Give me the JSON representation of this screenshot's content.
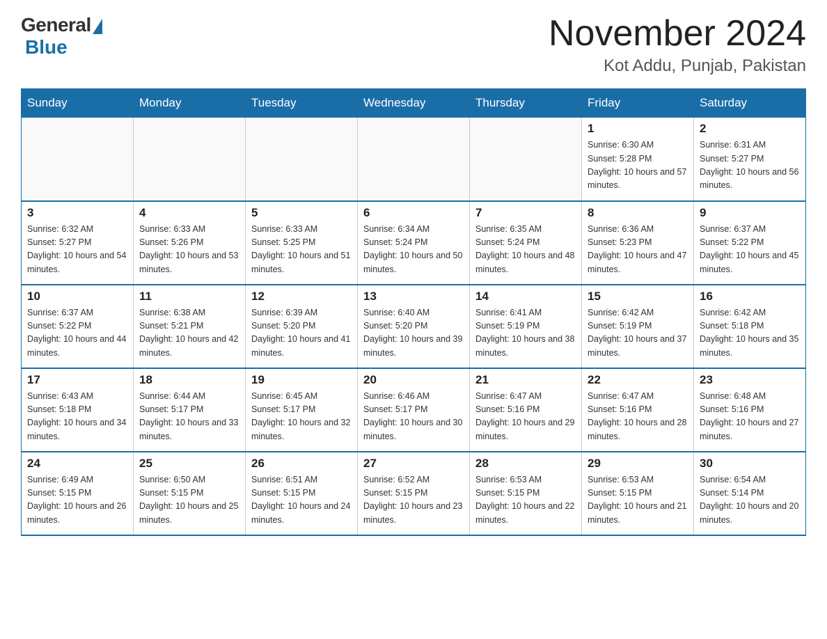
{
  "header": {
    "logo_general": "General",
    "logo_blue": "Blue",
    "month_title": "November 2024",
    "location": "Kot Addu, Punjab, Pakistan"
  },
  "days_of_week": [
    "Sunday",
    "Monday",
    "Tuesday",
    "Wednesday",
    "Thursday",
    "Friday",
    "Saturday"
  ],
  "weeks": [
    [
      {
        "day": "",
        "sunrise": "",
        "sunset": "",
        "daylight": ""
      },
      {
        "day": "",
        "sunrise": "",
        "sunset": "",
        "daylight": ""
      },
      {
        "day": "",
        "sunrise": "",
        "sunset": "",
        "daylight": ""
      },
      {
        "day": "",
        "sunrise": "",
        "sunset": "",
        "daylight": ""
      },
      {
        "day": "",
        "sunrise": "",
        "sunset": "",
        "daylight": ""
      },
      {
        "day": "1",
        "sunrise": "Sunrise: 6:30 AM",
        "sunset": "Sunset: 5:28 PM",
        "daylight": "Daylight: 10 hours and 57 minutes."
      },
      {
        "day": "2",
        "sunrise": "Sunrise: 6:31 AM",
        "sunset": "Sunset: 5:27 PM",
        "daylight": "Daylight: 10 hours and 56 minutes."
      }
    ],
    [
      {
        "day": "3",
        "sunrise": "Sunrise: 6:32 AM",
        "sunset": "Sunset: 5:27 PM",
        "daylight": "Daylight: 10 hours and 54 minutes."
      },
      {
        "day": "4",
        "sunrise": "Sunrise: 6:33 AM",
        "sunset": "Sunset: 5:26 PM",
        "daylight": "Daylight: 10 hours and 53 minutes."
      },
      {
        "day": "5",
        "sunrise": "Sunrise: 6:33 AM",
        "sunset": "Sunset: 5:25 PM",
        "daylight": "Daylight: 10 hours and 51 minutes."
      },
      {
        "day": "6",
        "sunrise": "Sunrise: 6:34 AM",
        "sunset": "Sunset: 5:24 PM",
        "daylight": "Daylight: 10 hours and 50 minutes."
      },
      {
        "day": "7",
        "sunrise": "Sunrise: 6:35 AM",
        "sunset": "Sunset: 5:24 PM",
        "daylight": "Daylight: 10 hours and 48 minutes."
      },
      {
        "day": "8",
        "sunrise": "Sunrise: 6:36 AM",
        "sunset": "Sunset: 5:23 PM",
        "daylight": "Daylight: 10 hours and 47 minutes."
      },
      {
        "day": "9",
        "sunrise": "Sunrise: 6:37 AM",
        "sunset": "Sunset: 5:22 PM",
        "daylight": "Daylight: 10 hours and 45 minutes."
      }
    ],
    [
      {
        "day": "10",
        "sunrise": "Sunrise: 6:37 AM",
        "sunset": "Sunset: 5:22 PM",
        "daylight": "Daylight: 10 hours and 44 minutes."
      },
      {
        "day": "11",
        "sunrise": "Sunrise: 6:38 AM",
        "sunset": "Sunset: 5:21 PM",
        "daylight": "Daylight: 10 hours and 42 minutes."
      },
      {
        "day": "12",
        "sunrise": "Sunrise: 6:39 AM",
        "sunset": "Sunset: 5:20 PM",
        "daylight": "Daylight: 10 hours and 41 minutes."
      },
      {
        "day": "13",
        "sunrise": "Sunrise: 6:40 AM",
        "sunset": "Sunset: 5:20 PM",
        "daylight": "Daylight: 10 hours and 39 minutes."
      },
      {
        "day": "14",
        "sunrise": "Sunrise: 6:41 AM",
        "sunset": "Sunset: 5:19 PM",
        "daylight": "Daylight: 10 hours and 38 minutes."
      },
      {
        "day": "15",
        "sunrise": "Sunrise: 6:42 AM",
        "sunset": "Sunset: 5:19 PM",
        "daylight": "Daylight: 10 hours and 37 minutes."
      },
      {
        "day": "16",
        "sunrise": "Sunrise: 6:42 AM",
        "sunset": "Sunset: 5:18 PM",
        "daylight": "Daylight: 10 hours and 35 minutes."
      }
    ],
    [
      {
        "day": "17",
        "sunrise": "Sunrise: 6:43 AM",
        "sunset": "Sunset: 5:18 PM",
        "daylight": "Daylight: 10 hours and 34 minutes."
      },
      {
        "day": "18",
        "sunrise": "Sunrise: 6:44 AM",
        "sunset": "Sunset: 5:17 PM",
        "daylight": "Daylight: 10 hours and 33 minutes."
      },
      {
        "day": "19",
        "sunrise": "Sunrise: 6:45 AM",
        "sunset": "Sunset: 5:17 PM",
        "daylight": "Daylight: 10 hours and 32 minutes."
      },
      {
        "day": "20",
        "sunrise": "Sunrise: 6:46 AM",
        "sunset": "Sunset: 5:17 PM",
        "daylight": "Daylight: 10 hours and 30 minutes."
      },
      {
        "day": "21",
        "sunrise": "Sunrise: 6:47 AM",
        "sunset": "Sunset: 5:16 PM",
        "daylight": "Daylight: 10 hours and 29 minutes."
      },
      {
        "day": "22",
        "sunrise": "Sunrise: 6:47 AM",
        "sunset": "Sunset: 5:16 PM",
        "daylight": "Daylight: 10 hours and 28 minutes."
      },
      {
        "day": "23",
        "sunrise": "Sunrise: 6:48 AM",
        "sunset": "Sunset: 5:16 PM",
        "daylight": "Daylight: 10 hours and 27 minutes."
      }
    ],
    [
      {
        "day": "24",
        "sunrise": "Sunrise: 6:49 AM",
        "sunset": "Sunset: 5:15 PM",
        "daylight": "Daylight: 10 hours and 26 minutes."
      },
      {
        "day": "25",
        "sunrise": "Sunrise: 6:50 AM",
        "sunset": "Sunset: 5:15 PM",
        "daylight": "Daylight: 10 hours and 25 minutes."
      },
      {
        "day": "26",
        "sunrise": "Sunrise: 6:51 AM",
        "sunset": "Sunset: 5:15 PM",
        "daylight": "Daylight: 10 hours and 24 minutes."
      },
      {
        "day": "27",
        "sunrise": "Sunrise: 6:52 AM",
        "sunset": "Sunset: 5:15 PM",
        "daylight": "Daylight: 10 hours and 23 minutes."
      },
      {
        "day": "28",
        "sunrise": "Sunrise: 6:53 AM",
        "sunset": "Sunset: 5:15 PM",
        "daylight": "Daylight: 10 hours and 22 minutes."
      },
      {
        "day": "29",
        "sunrise": "Sunrise: 6:53 AM",
        "sunset": "Sunset: 5:15 PM",
        "daylight": "Daylight: 10 hours and 21 minutes."
      },
      {
        "day": "30",
        "sunrise": "Sunrise: 6:54 AM",
        "sunset": "Sunset: 5:14 PM",
        "daylight": "Daylight: 10 hours and 20 minutes."
      }
    ]
  ]
}
